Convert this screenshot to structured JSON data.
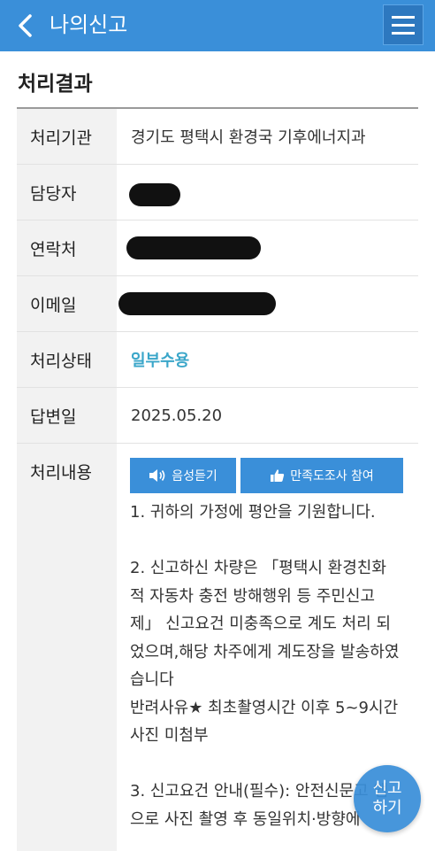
{
  "header": {
    "title": "나의신고",
    "back_icon": "chevron-left-icon",
    "menu_icon": "hamburger-menu-icon",
    "bar_color": "#3a8fd9"
  },
  "section_title": "처리결과",
  "rows": [
    {
      "label": "처리기관",
      "value": "경기도 평택시 환경국 기후에너지과"
    },
    {
      "label": "담당자",
      "value": ""
    },
    {
      "label": "연락처",
      "value": ""
    },
    {
      "label": "이메일",
      "value": ""
    },
    {
      "label": "처리상태",
      "value": "일부수용",
      "value_color": "#3aa6c9"
    },
    {
      "label": "답변일",
      "value": "2025.05.20"
    },
    {
      "label": "처리내용"
    }
  ],
  "buttons": {
    "tts_label": "음성듣기",
    "tts_icon": "speaker-icon",
    "survey_label": "만족도조사 참여",
    "survey_icon": "thumbs-up-icon"
  },
  "reply_text": "1. 귀하의 가정에 평안을 기원합니다.\n\n2. 신고하신 차량은 「평택시 환경친화적 자동차 충전 방해행위 등 주민신고제」 신고요건 미충족으로 계도 처리 되었으며,해당 차주에게 계도장을 발송하였습니다\n반려사유★ 최초촬영시간 이후 5~9시간 사진 미첨부\n\n3. 신고요건 안내(필수): 안전신문고 앱으로 사진 촬영 후 동일위치·방향에",
  "fab": {
    "line1": "신고",
    "line2": "하기"
  }
}
